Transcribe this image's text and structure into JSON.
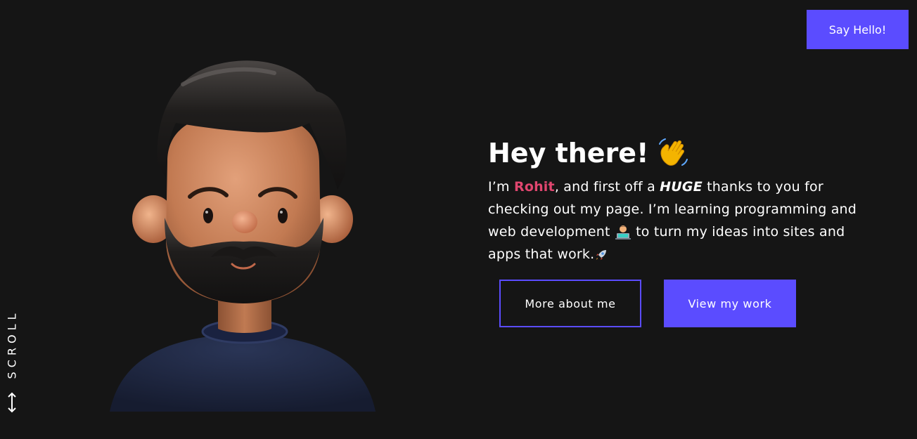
{
  "header": {
    "say_hello_label": "Say Hello!"
  },
  "scroll": {
    "label": "SCROLL",
    "icon": "double-arrow-vertical-icon"
  },
  "avatar": {
    "icon": "memoji-avatar",
    "colors": {
      "skin": "#c9825a",
      "hair": "#1c1a19",
      "shirt": "#1f2740"
    }
  },
  "intro": {
    "greeting": "Hey there!",
    "greeting_icon": "waving-hand-icon",
    "bio": {
      "prefix": "I’m ",
      "name": "Rohit",
      "after_name": ", and first off a ",
      "emphasis": "HUGE",
      "after_emphasis": " thanks to you for checking out my page. I’m learning programming and web development ",
      "laptop_icon": "technologist-icon",
      "after_laptop": " to turn my ideas into sites and apps that work.",
      "rocket_icon": "rocket-icon"
    }
  },
  "cta": {
    "more_about_label": "More about me",
    "view_work_label": "View my work"
  },
  "colors": {
    "background": "#151515",
    "accent": "#5b4cff",
    "name_highlight": "#e0466f",
    "text": "#ffffff"
  }
}
